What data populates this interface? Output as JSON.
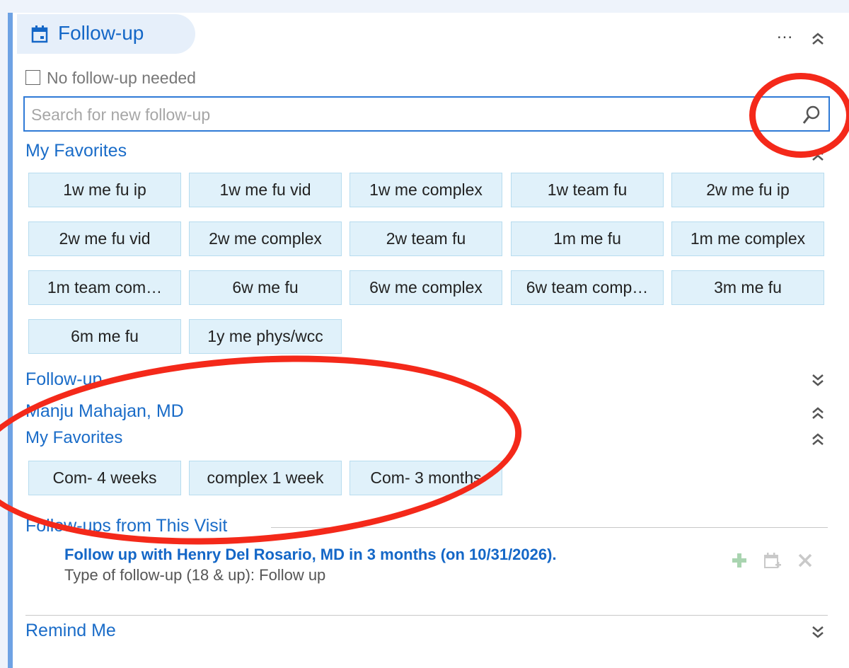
{
  "header": {
    "title": "Follow-up",
    "more_label": "..."
  },
  "no_followup": {
    "label": "No follow-up needed",
    "checked": false
  },
  "search": {
    "placeholder": "Search for new follow-up",
    "value": ""
  },
  "my_favorites": {
    "label": "My Favorites",
    "buttons": [
      "1w me fu ip",
      "1w me fu vid",
      "1w me complex",
      "1w team fu",
      "2w me fu ip",
      "2w me fu vid",
      "2w me complex",
      "2w team fu",
      "1m me fu",
      "1m me complex",
      "1m team com…",
      "6w me fu",
      "6w me complex",
      "6w team comp…",
      "3m me fu",
      "6m me fu",
      "1y me phys/wcc"
    ]
  },
  "followup_section": {
    "label": "Follow-up"
  },
  "provider": {
    "name": "Manju Mahajan, MD",
    "favorites_label": "My Favorites",
    "buttons": [
      "Com- 4 weeks",
      "complex 1 week",
      "Com- 3 months"
    ]
  },
  "this_visit": {
    "label": "Follow-ups from This Visit",
    "item_title": "Follow up with Henry Del Rosario, MD in 3 months (on 10/31/2026).",
    "item_sub": "Type of follow-up (18 & up): Follow up"
  },
  "remind_me": {
    "label": "Remind Me"
  },
  "colors": {
    "accent": "#1467c7",
    "annotation": "#f4291a",
    "button_bg": "#e0f1fa"
  }
}
